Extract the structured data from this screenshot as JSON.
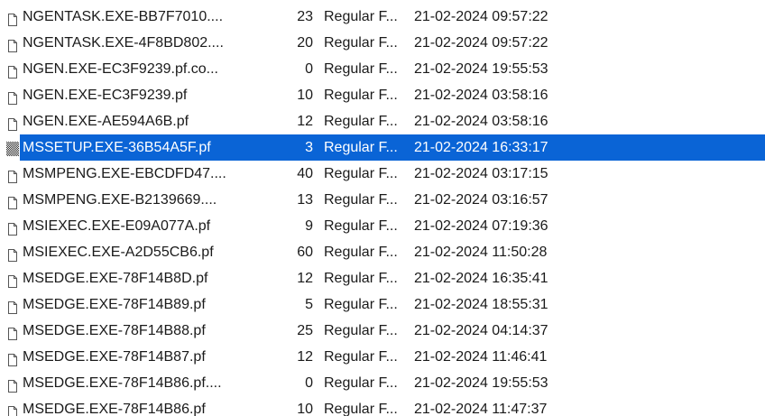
{
  "file_list": {
    "rows": [
      {
        "name": "NGENTASK.EXE-BB7F7010....",
        "size": "23",
        "type": "Regular F...",
        "date": "21-02-2024 09:57:22",
        "icon": "file-icon",
        "selected": false
      },
      {
        "name": "NGENTASK.EXE-4F8BD802....",
        "size": "20",
        "type": "Regular F...",
        "date": "21-02-2024 09:57:22",
        "icon": "file-icon",
        "selected": false
      },
      {
        "name": "NGEN.EXE-EC3F9239.pf.co...",
        "size": "0",
        "type": "Regular F...",
        "date": "21-02-2024 19:55:53",
        "icon": "file-icon",
        "selected": false
      },
      {
        "name": "NGEN.EXE-EC3F9239.pf",
        "size": "10",
        "type": "Regular F...",
        "date": "21-02-2024 03:58:16",
        "icon": "file-icon",
        "selected": false
      },
      {
        "name": "NGEN.EXE-AE594A6B.pf",
        "size": "12",
        "type": "Regular F...",
        "date": "21-02-2024 03:58:16",
        "icon": "file-icon",
        "selected": false
      },
      {
        "name": "MSSETUP.EXE-36B54A5F.pf",
        "size": "3",
        "type": "Regular F...",
        "date": "21-02-2024 16:33:17",
        "icon": "file-icon-selected",
        "selected": true
      },
      {
        "name": "MSMPENG.EXE-EBCDFD47....",
        "size": "40",
        "type": "Regular F...",
        "date": "21-02-2024 03:17:15",
        "icon": "file-icon",
        "selected": false
      },
      {
        "name": "MSMPENG.EXE-B2139669....",
        "size": "13",
        "type": "Regular F...",
        "date": "21-02-2024 03:16:57",
        "icon": "file-icon",
        "selected": false
      },
      {
        "name": "MSIEXEC.EXE-E09A077A.pf",
        "size": "9",
        "type": "Regular F...",
        "date": "21-02-2024 07:19:36",
        "icon": "file-icon",
        "selected": false
      },
      {
        "name": "MSIEXEC.EXE-A2D55CB6.pf",
        "size": "60",
        "type": "Regular F...",
        "date": "21-02-2024 11:50:28",
        "icon": "file-icon",
        "selected": false
      },
      {
        "name": "MSEDGE.EXE-78F14B8D.pf",
        "size": "12",
        "type": "Regular F...",
        "date": "21-02-2024 16:35:41",
        "icon": "file-icon",
        "selected": false
      },
      {
        "name": "MSEDGE.EXE-78F14B89.pf",
        "size": "5",
        "type": "Regular F...",
        "date": "21-02-2024 18:55:31",
        "icon": "file-icon",
        "selected": false
      },
      {
        "name": "MSEDGE.EXE-78F14B88.pf",
        "size": "25",
        "type": "Regular F...",
        "date": "21-02-2024 04:14:37",
        "icon": "file-icon",
        "selected": false
      },
      {
        "name": "MSEDGE.EXE-78F14B87.pf",
        "size": "12",
        "type": "Regular F...",
        "date": "21-02-2024 11:46:41",
        "icon": "file-icon",
        "selected": false
      },
      {
        "name": "MSEDGE.EXE-78F14B86.pf....",
        "size": "0",
        "type": "Regular F...",
        "date": "21-02-2024 19:55:53",
        "icon": "file-icon",
        "selected": false
      },
      {
        "name": "MSEDGE.EXE-78F14B86.pf",
        "size": "10",
        "type": "Regular F...",
        "date": "21-02-2024 11:47:37",
        "icon": "file-icon",
        "selected": false
      }
    ]
  },
  "colors": {
    "selection": "#0a64d6",
    "selected_text": "#ffffff",
    "text": "#1a1a1a",
    "background": "#ffffff"
  }
}
